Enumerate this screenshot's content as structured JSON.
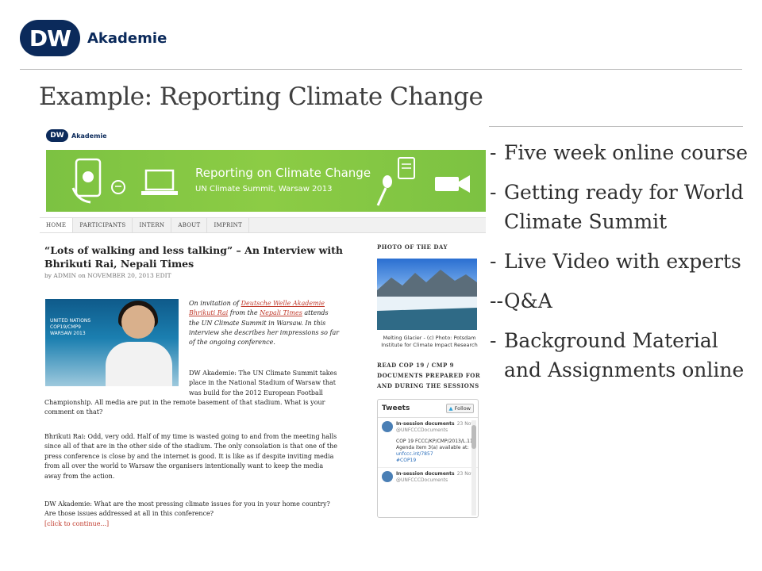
{
  "logo": {
    "mark": "DW",
    "name": "Akademie"
  },
  "slide_title": "Example:  Reporting Climate Change",
  "screenshot": {
    "logo": {
      "mark": "DW",
      "name": "Akademie"
    },
    "banner": {
      "title": "Reporting on Climate Change",
      "subtitle": "UN Climate Summit, Warsaw 2013"
    },
    "tabs": [
      "HOME",
      "PARTICIPANTS",
      "INTERN",
      "ABOUT",
      "IMPRINT"
    ],
    "article": {
      "title": "“Lots of walking and less talking” – An Interview with Bhrikuti Rai, Nepali Times",
      "meta": "by ADMIN on NOVEMBER 20, 2013  EDIT",
      "photo_logo": "UNITED NATIONS\nCOP19/CMP9\nWARSAW 2013",
      "intro_1": "On invitation of ",
      "intro_link_1": "Deutsche Welle Akademie",
      "intro_2": " ",
      "intro_link_2": "Bhrikuti Rai",
      "intro_3": " from the ",
      "intro_link_3": "Nepali Times",
      "intro_4": " attends the UN Climate Summit in Warsaw. In this interview she describes her impressions so far of the ongoing conference.",
      "para_1a": "DW Akademie: The UN Climate Summit takes place in the National Stadium of Warsaw that was build for the 2012 European Football",
      "para_1b": "Championship. All media are put in the remote basement of that stadium. What is your comment on that?",
      "para_2": "Bhrikuti Rai: Odd, very odd. Half of my time is wasted going to and from the meeting halls since all of that are in the other side of the stadium. The only consolation is that one of the press conference is close by and the internet is good. It is like as if despite inviting media from all over the world to Warsaw the organisers intentionally want to keep the media away from the action.",
      "para_3": "DW Akademie: What are the most pressing climate issues for you in your home country? Are those issues addressed at all in this conference?",
      "continue": "[click to continue...]"
    },
    "sidebar": {
      "photo_heading": "PHOTO OF THE DAY",
      "photo_caption": "Melting Glacier - (c) Photo: Potsdam Institute for Climate Impact Research",
      "docs_heading": "READ COP 19 / CMP 9 DOCUMENTS PREPARED FOR AND DURING THE SESSIONS",
      "tweets_title": "Tweets",
      "follow_label": "Follow",
      "tweets": [
        {
          "name": "In-session documents",
          "handle": "@UNFCCCDocuments",
          "date": "23 Nov",
          "text": "COP 19 FCCC/KP/CMP/2013/L.11 Agenda item 3(a) available at:",
          "link": "unfccc.int/7857",
          "tag": "#COP19"
        },
        {
          "name": "In-session documents",
          "handle": "@UNFCCCDocuments",
          "date": "23 Nov",
          "text": "",
          "link": "",
          "tag": ""
        }
      ]
    }
  },
  "bullets": [
    {
      "dash": "- ",
      "text": "Five week online course"
    },
    {
      "dash": "-",
      "text": "Getting ready for World Climate Summit"
    },
    {
      "dash": "-",
      "text": "Live Video with experts"
    },
    {
      "dash": "--",
      "text": "Q&A"
    },
    {
      "dash": "-",
      "text": "Background Material and Assignments online"
    }
  ],
  "colors": {
    "brand_navy": "#0b2a5b",
    "banner_green": "#7cc242",
    "link_red": "#c0392b"
  }
}
